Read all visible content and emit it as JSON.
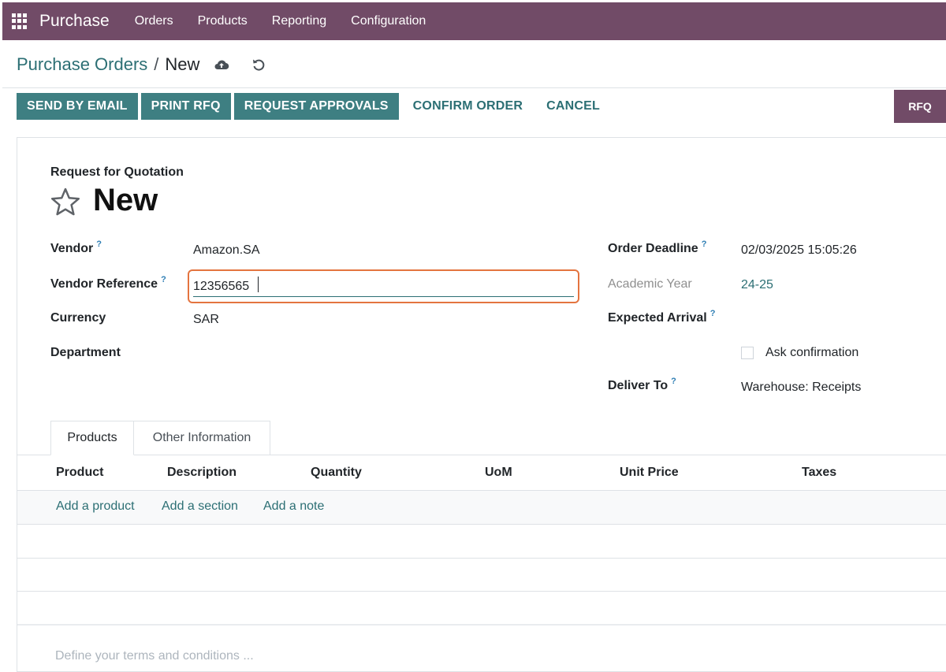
{
  "navbar": {
    "app_name": "Purchase",
    "menu": [
      "Orders",
      "Products",
      "Reporting",
      "Configuration"
    ],
    "color": "#714b67"
  },
  "breadcrumb": {
    "parent": "Purchase Orders",
    "separator": "/",
    "current": "New"
  },
  "actions": {
    "send_by_email": "SEND BY EMAIL",
    "print_rfq": "PRINT RFQ",
    "request_approvals": "REQUEST APPROVALS",
    "confirm_order": "CONFIRM ORDER",
    "cancel": "CANCEL",
    "status": "RFQ"
  },
  "form": {
    "subtitle": "Request for Quotation",
    "title": "New",
    "left": {
      "vendor_label": "Vendor",
      "vendor_value": "Amazon.SA",
      "vendor_ref_label": "Vendor Reference",
      "vendor_ref_value": "12356565",
      "currency_label": "Currency",
      "currency_value": "SAR",
      "department_label": "Department"
    },
    "right": {
      "deadline_label": "Order Deadline",
      "deadline_value": "02/03/2025 15:05:26",
      "academic_year_label": "Academic Year",
      "academic_year_value": "24-25",
      "expected_arrival_label": "Expected Arrival",
      "ask_confirmation_label": "Ask confirmation",
      "deliver_to_label": "Deliver To",
      "deliver_to_value": "Warehouse: Receipts"
    },
    "help_mark": "?"
  },
  "tabs": [
    "Products",
    "Other Information"
  ],
  "table": {
    "headers": [
      "Product",
      "Description",
      "Quantity",
      "UoM",
      "Unit Price",
      "Taxes"
    ],
    "add_links": [
      "Add a product",
      "Add a section",
      "Add a note"
    ]
  },
  "terms_placeholder": "Define your terms and conditions ...",
  "icons": {
    "apps": "apps-grid-icon",
    "save": "cloud-upload-icon",
    "discard": "undo-icon",
    "favorite": "star-icon"
  },
  "colors": {
    "accent": "#3e7f82",
    "link": "#2c6f74",
    "highlight": "#e4743f"
  }
}
